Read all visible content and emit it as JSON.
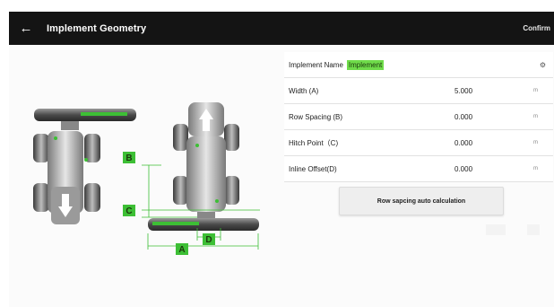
{
  "header": {
    "back_icon": "arrow-left-icon",
    "title": "Implement Geometry",
    "confirm_label": "Confirm"
  },
  "form": {
    "name_label": "Implement Name",
    "name_value": "Implement",
    "settings_icon": "gear-icon",
    "fields": [
      {
        "label": "Width (A)",
        "value": "5.000",
        "unit": "m"
      },
      {
        "label": "Row Spacing (B)",
        "value": "0.000",
        "unit": "m"
      },
      {
        "label": "Hitch Point（C)",
        "value": "0.000",
        "unit": "m"
      },
      {
        "label": "Inline Offset(D)",
        "value": "0.000",
        "unit": "m"
      }
    ],
    "calc_button_label": "Row sapcing auto calculation"
  },
  "diagram": {
    "labels": {
      "a": "A",
      "b": "B",
      "c": "C",
      "d": "D"
    }
  },
  "colors": {
    "accent": "#3dbf35",
    "highlight": "#6fdc4a",
    "header_bg": "#141414"
  }
}
